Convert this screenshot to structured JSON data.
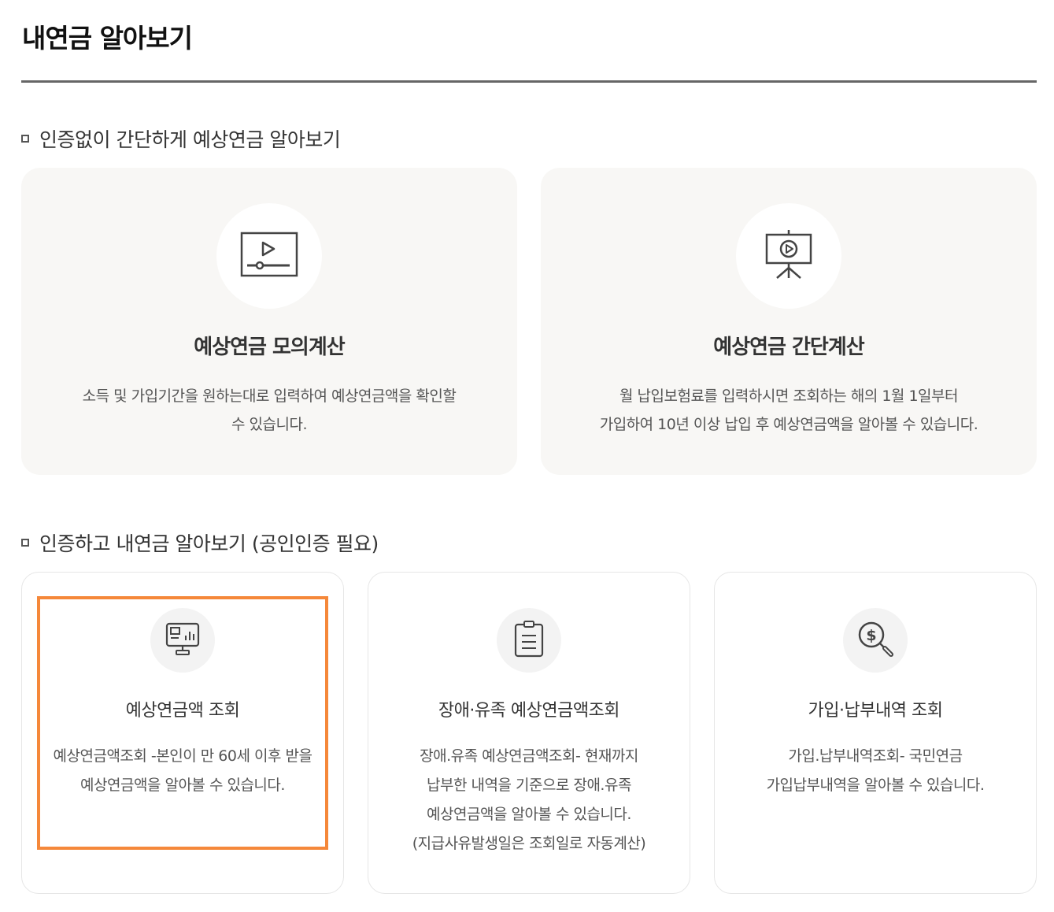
{
  "page": {
    "title": "내연금 알아보기"
  },
  "section1": {
    "heading": "인증없이 간단하게 예상연금 알아보기",
    "cards": [
      {
        "icon": "video-player-icon",
        "title": "예상연금 모의계산",
        "desc_line1": "소득 및 가입기간을 원하는대로 입력하여 예상연금액을 확인할",
        "desc_line2": "수 있습니다."
      },
      {
        "icon": "presentation-easel-icon",
        "title": "예상연금 간단계산",
        "desc_line1": "월 납입보험료를 입력하시면 조회하는 해의 1월 1일부터",
        "desc_line2": "가입하여 10년 이상 납입 후 예상연금액을 알아볼 수 있습니다."
      }
    ]
  },
  "section2": {
    "heading": "인증하고 내연금 알아보기 (공인인증 필요)",
    "cards": [
      {
        "icon": "monitor-chart-icon",
        "title": "예상연금액 조회",
        "desc_lines": [
          "예상연금액조회 -본인이 만 60세 이후 받을",
          "예상연금액을 알아볼 수 있습니다."
        ]
      },
      {
        "icon": "clipboard-list-icon",
        "title": "장애·유족 예상연금액조회",
        "desc_lines": [
          "장애.유족 예상연금액조회- 현재까지",
          "납부한 내역을 기준으로 장애.유족",
          "예상연금액을 알아볼 수 있습니다.",
          "(지급사유발생일은 조회일로 자동계산)"
        ]
      },
      {
        "icon": "dollar-magnifier-icon",
        "title": "가입·납부내역 조회",
        "desc_lines": [
          "가입.납부내역조회- 국민연금",
          "가입납부내역을 알아볼 수 있습니다."
        ]
      }
    ]
  },
  "highlight_color": "#f5883a"
}
